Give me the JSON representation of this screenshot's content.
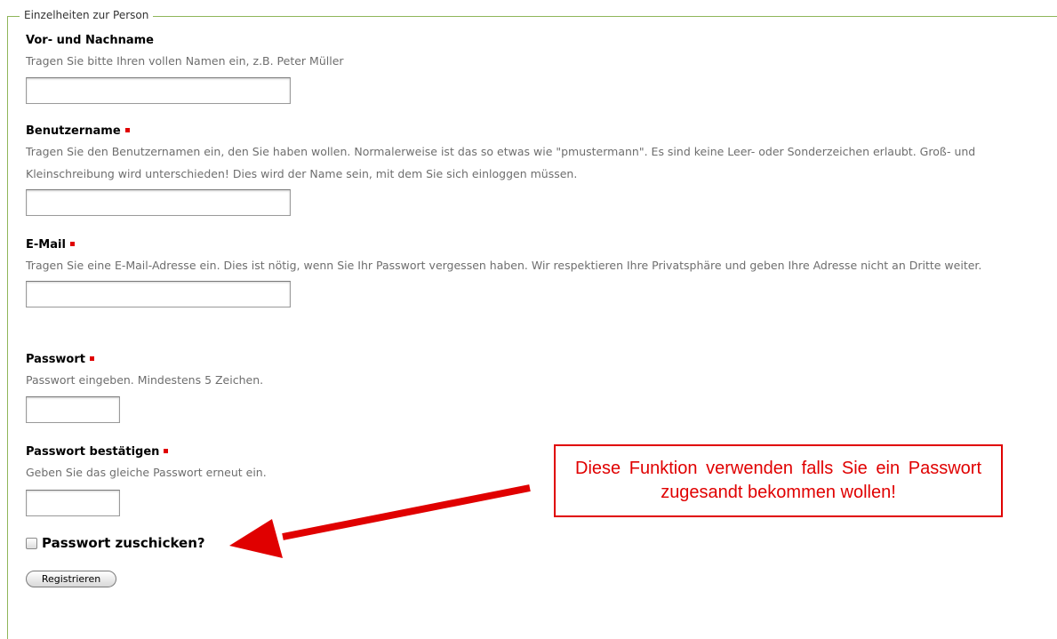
{
  "fieldset": {
    "legend": "Einzelheiten zur Person"
  },
  "fields": {
    "fullname": {
      "label": "Vor- und Nachname",
      "help": "Tragen Sie bitte Ihren vollen Namen ein, z.B. Peter Müller",
      "value": ""
    },
    "username": {
      "label": "Benutzername",
      "help": "Tragen Sie den Benutzernamen ein, den Sie haben wollen. Normalerweise ist das so etwas wie \"pmustermann\". Es sind keine Leer- oder Sonderzeichen erlaubt. Groß- und Kleinschreibung wird unterschieden! Dies wird der Name sein, mit dem Sie sich einloggen müssen.",
      "value": ""
    },
    "email": {
      "label": "E-Mail",
      "help": "Tragen Sie eine E-Mail-Adresse ein. Dies ist nötig, wenn Sie Ihr Passwort vergessen haben. Wir respektieren Ihre Privatsphäre und geben Ihre Adresse nicht an Dritte weiter.",
      "value": ""
    },
    "password": {
      "label": "Passwort",
      "help": "Passwort eingeben. Mindestens 5 Zeichen.",
      "value": ""
    },
    "password_confirm": {
      "label": "Passwort bestätigen",
      "help": "Geben Sie das gleiche Passwort erneut ein.",
      "value": ""
    }
  },
  "send_password": {
    "label": "Passwort zuschicken?",
    "checked": false
  },
  "submit": {
    "label": "Registrieren"
  },
  "annotation": {
    "text": "Diese Funktion verwenden falls Sie ein Passwort zugesandt bekommen wollen!",
    "color": "#e00000"
  },
  "colors": {
    "border_accent": "#8fb65a",
    "required_marker": "#e00000",
    "help_text": "#6e6e6e"
  }
}
